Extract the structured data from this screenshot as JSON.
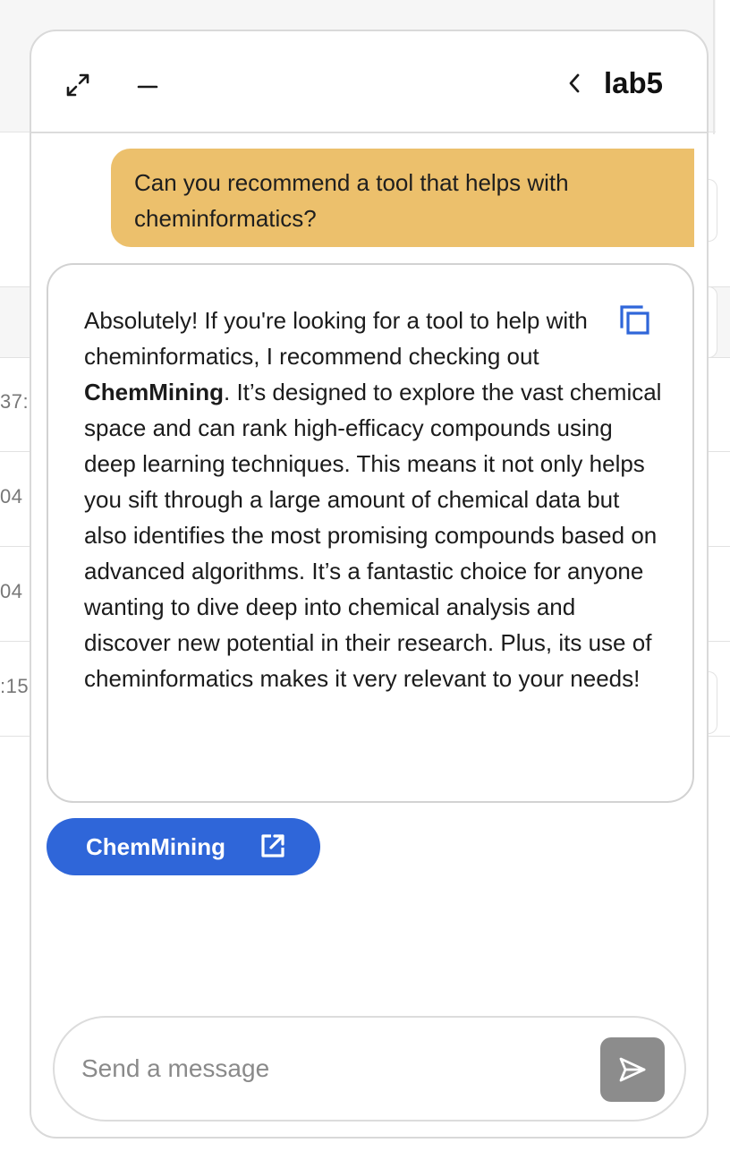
{
  "background": {
    "row_fragments": [
      "37:",
      "04",
      "04",
      ":15"
    ]
  },
  "header": {
    "title": "lab5",
    "expand_icon": "expand-icon",
    "minimize_icon": "minimize-icon",
    "back_icon": "chevron-left-icon"
  },
  "conversation": {
    "user_message": "Can you recommend a tool that helps with cheminformatics?",
    "bot_message": {
      "part1": "Absolutely! If you're looking for a tool to help with cheminformatics, I recommend checking out ",
      "tool_name": "ChemMining",
      "part2": ". It’s designed to explore the vast chemical space and can rank high-efficacy compounds using deep learning techniques. This means it not only helps you sift through a large amount of chemical data but also identifies the most promising compounds based on advanced algorithms. It’s a fantastic choice for anyone wanting to dive deep into chemical analysis and discover new potential in their research. Plus, its use of cheminformatics makes it very relevant to your needs!"
    },
    "copy_icon": "copy-icon",
    "link_chip": {
      "label": "ChemMining",
      "icon": "external-link-icon"
    }
  },
  "composer": {
    "placeholder": "Send a message",
    "value": "",
    "send_icon": "send-icon"
  },
  "colors": {
    "user_bubble": "#ecc06c",
    "link_chip": "#2f66d9",
    "copy_icon": "#2f66d9",
    "send_button": "#8c8c8c"
  }
}
